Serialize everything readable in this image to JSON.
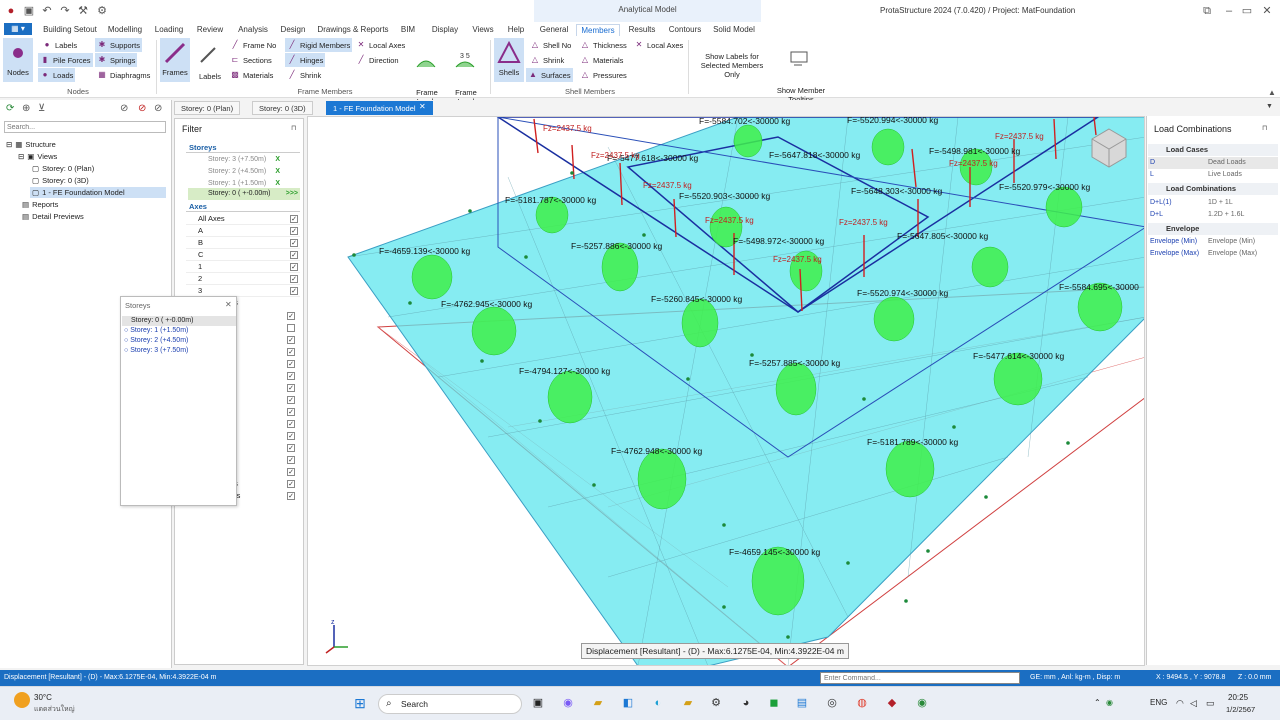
{
  "app_title": "ProtaStructure 2024 (7.0.420) / Project: MatFoundation",
  "context_tab_title": "Analytical Model",
  "menu_tabs": [
    "Building Setout",
    "Modelling",
    "Loading",
    "Review",
    "Analysis",
    "Design",
    "Drawings & Reports",
    "BIM",
    "Display",
    "Views",
    "Help"
  ],
  "context_tabs": [
    "General",
    "Members",
    "Results",
    "Contours",
    "Solid Model"
  ],
  "active_context_tab": "Members",
  "ribbon": {
    "nodes": {
      "big": "Nodes",
      "labels": "Labels",
      "pile_forces": "Pile Forces",
      "loads": "Loads",
      "supports": "Supports",
      "springs": "Springs",
      "diaphragms": "Diaphragms",
      "group": "Nodes"
    },
    "frame": {
      "frames": "Frames",
      "labels": "Labels",
      "frame_no": "Frame No",
      "sections": "Sections",
      "materials": "Materials",
      "rigid_members": "Rigid Members",
      "hinges": "Hinges",
      "shrink": "Shrink",
      "local_axes": "Local Axes",
      "direction": "Direction",
      "frame_loads": "Frame\nLoads",
      "frame_load_labels": "Frame Load\nLabels",
      "group": "Frame Members"
    },
    "shell": {
      "shells": "Shells",
      "shell_no": "Shell No",
      "shrink": "Shrink",
      "surfaces": "Surfaces",
      "thickness": "Thickness",
      "materials": "Materials",
      "pressures": "Pressures",
      "local_axes": "Local Axes",
      "group": "Shell Members"
    },
    "show_labels": "Show Labels for\nSelected Members Only",
    "show_tooltips": "Show Member\nTooltips"
  },
  "left_pane": {
    "search_placeholder": "Search...",
    "tree": {
      "structure": "Structure",
      "views": "Views",
      "view1": "Storey: 0 (Plan)",
      "view2": "Storey: 0 (3D)",
      "view3": "1 - FE Foundation Model",
      "reports": "Reports",
      "detail": "Detail Previews"
    }
  },
  "doc_tabs": [
    "Storey: 0 (Plan)",
    "Storey: 0 (3D)",
    "1 - FE Foundation Model"
  ],
  "filter": {
    "title": "Filter",
    "storeys_header": "Storeys",
    "storeys": [
      {
        "label": "Storey: 3 (+7.50m)",
        "mark": "X"
      },
      {
        "label": "Storey: 2 (+4.50m)",
        "mark": "X"
      },
      {
        "label": "Storey: 1 (+1.50m)",
        "mark": "X"
      },
      {
        "label": "Storey: 0 ( +-0.00m)",
        "mark": ">>>"
      }
    ],
    "axes_header": "Axes",
    "axes": [
      "All Axes",
      "A",
      "B",
      "C",
      "1",
      "2",
      "3"
    ],
    "partial_labels": [
      "es",
      "s",
      "ps",
      "ers"
    ]
  },
  "storeys_popup": {
    "title": "Storeys",
    "items": [
      "Storey: 0 ( +-0.00m)",
      "Storey: 1 (+1.50m)",
      "Storey: 2 (+4.50m)",
      "Storey: 3 (+7.50m)"
    ]
  },
  "viewport": {
    "pile_labels": [
      "F=-5584.702<-30000 kg",
      "F=-5520.994<-30000 kg",
      "F=-5477.618<-30000 kg",
      "F=-5647.818<-30000 kg",
      "F=-5498.981<-30000 kg",
      "F=-5181.787<-30000 kg",
      "F=-5520.903<-30000 kg",
      "F=-5648.303<-30000 kg",
      "F=-5520.979<-30000 kg",
      "F=-4659.139<-30000 kg",
      "F=-5257.886<-30000 kg",
      "F=-5498.972<-30000 kg",
      "F=-5647.805<-30000 kg",
      "F=-4762.945<-30000 kg",
      "F=-5260.845<-30000 kg",
      "F=-5520.974<-30000 kg",
      "F=-5584.695<-30000",
      "F=-4794.127<-30000 kg",
      "F=-5257.885<-30000 kg",
      "F=-5477.614<-30000 kg",
      "F=-5181.789<-30000 kg",
      "F=-4762.948<-30000 kg",
      "F=-4659.145<-30000 kg"
    ],
    "fz_label": "Fz=2437.5 kg",
    "legend": "Displacement [Resultant] - (D) -  Max:6.1275E-04, Min:4.3922E-04 m"
  },
  "right_pane": {
    "title": "Load Combinations",
    "load_cases_header": "Load Cases",
    "load_cases": [
      {
        "code": "D",
        "desc": "Dead Loads"
      },
      {
        "code": "L",
        "desc": "Live Loads"
      }
    ],
    "combos_header": "Load Combinations",
    "combos": [
      {
        "code": "D+L(1)",
        "desc": "1D + 1L"
      },
      {
        "code": "D+L",
        "desc": "1.2D + 1.6L"
      }
    ],
    "envelope_header": "Envelope",
    "envelopes": [
      {
        "code": "Envelope (Min)",
        "desc": "Envelope (Min)"
      },
      {
        "code": "Envelope (Max)",
        "desc": "Envelope (Max)"
      }
    ]
  },
  "status": {
    "left": "Displacement [Resultant] - (D) - Max:6.1275E-04, Min:4.3922E-04 m",
    "command_placeholder": "Enter Command...",
    "units": "GE: mm , Anl: kg-m , Disp: m",
    "coords": "X : 9494.5 , Y : 9078.8",
    "z": "Z : 0.0 mm"
  },
  "taskbar": {
    "temp": "30°C",
    "weather": "แดดส่วนใหญ่",
    "search": "Search",
    "lang": "ENG",
    "time": "20:25",
    "date": "1/2/2567"
  }
}
